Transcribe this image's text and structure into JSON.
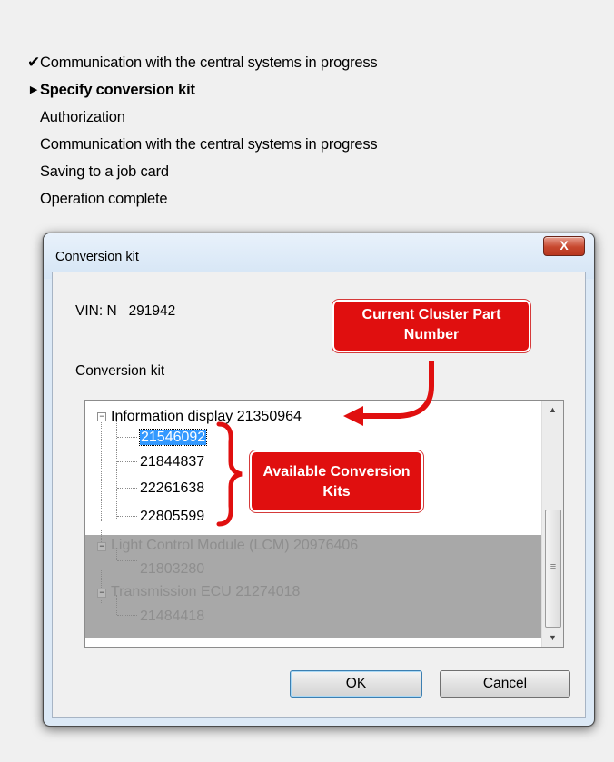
{
  "steps": [
    {
      "status": "done",
      "icon": "check-icon",
      "label": "Communication with the central systems in progress"
    },
    {
      "status": "current",
      "icon": "arrow-right-icon",
      "label": "Specify conversion kit"
    },
    {
      "status": "pending",
      "label": "Authorization"
    },
    {
      "status": "pending",
      "label": "Communication with the central systems in progress"
    },
    {
      "status": "pending",
      "label": "Saving to a job card"
    },
    {
      "status": "pending",
      "label": "Operation complete"
    }
  ],
  "dialog": {
    "title": "Conversion kit",
    "close_label": "X",
    "vin": "VIN: N   291942",
    "conversion_kit_label": "Conversion kit",
    "tree": [
      {
        "label": "Information display 21350964",
        "enabled": true,
        "children": [
          {
            "label": "21546092",
            "selected": true
          },
          {
            "label": "21844837"
          },
          {
            "label": "22261638"
          },
          {
            "label": "22805599"
          }
        ]
      },
      {
        "label": "Light Control Module (LCM) 20976406",
        "enabled": false,
        "children": [
          {
            "label": "21803280"
          }
        ]
      },
      {
        "label": "Transmission ECU 21274018",
        "enabled": false,
        "children": [
          {
            "label": "21484418"
          }
        ]
      }
    ],
    "ok_label": "OK",
    "cancel_label": "Cancel"
  },
  "annotations": {
    "current_cluster": "Current Cluster Part Number",
    "available_kits": "Available Conversion Kits",
    "color": "#e00f0f"
  }
}
